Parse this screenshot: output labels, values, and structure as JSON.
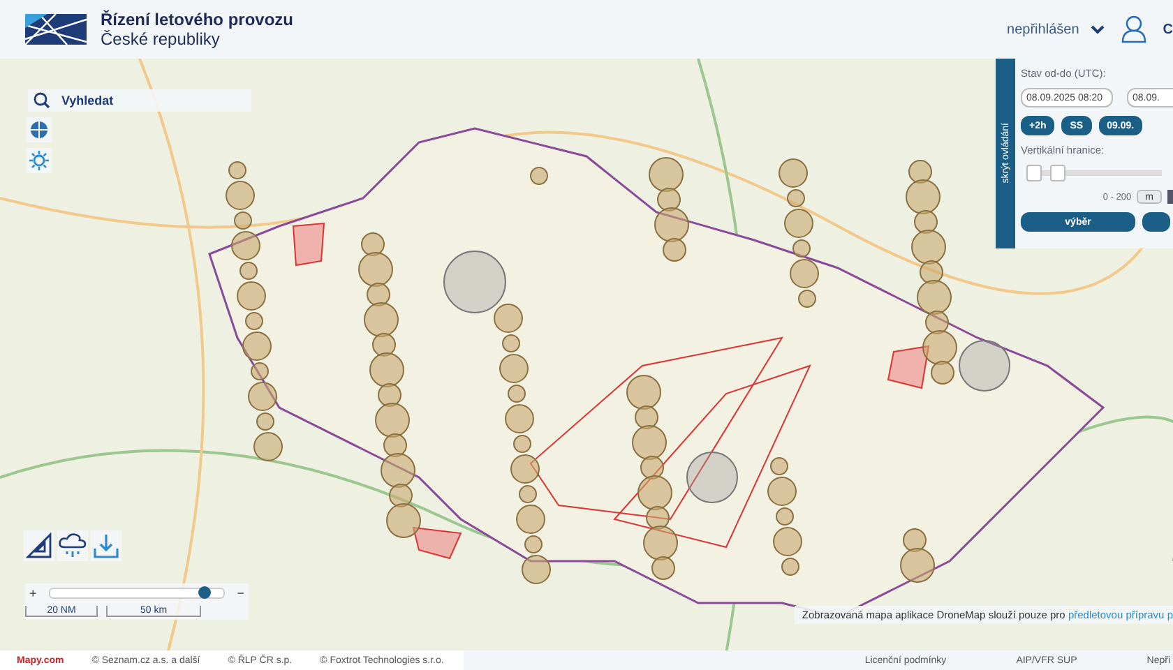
{
  "header": {
    "title_line1": "Řízení letového provozu",
    "title_line2": "České republiky",
    "user_status": "nepřihlášen",
    "languages": [
      {
        "label": "C",
        "selected": true
      }
    ]
  },
  "search": {
    "placeholder": "Vyhledat"
  },
  "control_panel": {
    "toggle_label": "skrýt ovládání",
    "range_label": "Stav od-do (UTC):",
    "from_value": "08.09.2025 08:20",
    "to_value": "08.09.",
    "quick_buttons": [
      "+2h",
      "SS",
      "09.09."
    ],
    "vertical_label": "Vertikální hranice:",
    "thumbs": [
      {
        "level": 0.0
      },
      {
        "level": 0.2
      }
    ],
    "vertical_range": "0 - 200",
    "units": [
      {
        "label": "m",
        "selected": false
      }
    ],
    "action_buttons": [
      "výběr"
    ]
  },
  "zoom": {
    "zoom_in": "+",
    "zoom_out": "−",
    "level": 0.92,
    "scale_nm": "20 NM",
    "scale_km": "50 km"
  },
  "notice": {
    "text": "Zobrazovaná mapa aplikace DroneMap slouží pouze pro ",
    "link": "předletovou přípravu p"
  },
  "footer": {
    "logo": "Mapy.com",
    "credits": [
      "© Seznam.cz a.s. a další",
      "© ŘLP ČR s.p.",
      "© Foxtrot Technologies s.r.o."
    ],
    "links": [
      "Licenční podmínky",
      "AIP/VFR SUP",
      "Nepři"
    ]
  }
}
